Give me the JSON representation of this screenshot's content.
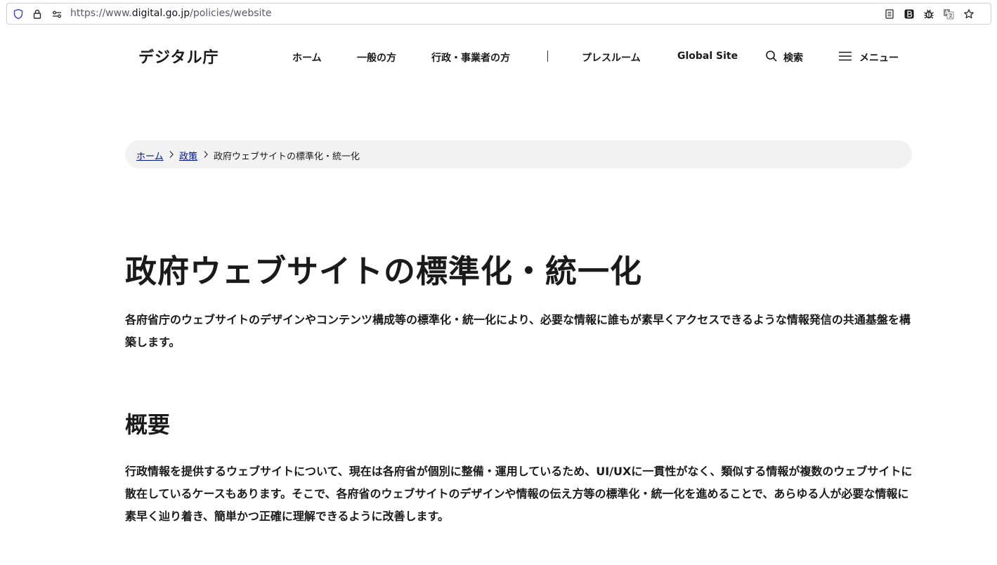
{
  "browser": {
    "url_scheme": "https://www.",
    "url_host": "digital.go.jp",
    "url_path": "/policies/website",
    "icons": [
      "shield-icon",
      "lock-icon",
      "permissions-icon",
      "reader-view-icon",
      "extension-b-icon",
      "bug-icon",
      "translate-icon",
      "bookmark-star-icon"
    ]
  },
  "header": {
    "logo": "デジタル庁",
    "nav": {
      "home": "ホーム",
      "general": "一般の方",
      "government": "行政・事業者の方",
      "press": "プレスルーム",
      "global": "Global Site",
      "search": "検索",
      "menu": "メニュー"
    }
  },
  "breadcrumb": {
    "home": "ホーム",
    "policies": "政策",
    "current": "政府ウェブサイトの標準化・統一化"
  },
  "main": {
    "title": "政府ウェブサイトの標準化・統一化",
    "lead": "各府省庁のウェブサイトのデザインやコンテンツ構成等の標準化・統一化により、必要な情報に誰もが素早くアクセスできるような情報発信の共通基盤を構築します。",
    "section_heading": "概要",
    "section_body": "行政情報を提供するウェブサイトについて、現在は各府省が個別に整備・運用しているため、UI/UXに一貫性がなく、類似する情報が複数のウェブサイトに散在しているケースもあります。そこで、各府省のウェブサイトのデザインや情報の伝え方等の標準化・統一化を進めることで、あらゆる人が必要な情報に素早く辿り着き、簡単かつ正確に理解できるように改善します。"
  },
  "colors": {
    "link": "#00118f",
    "text": "#1a1a1a",
    "breadcrumb_bg": "#f2f2f2"
  }
}
